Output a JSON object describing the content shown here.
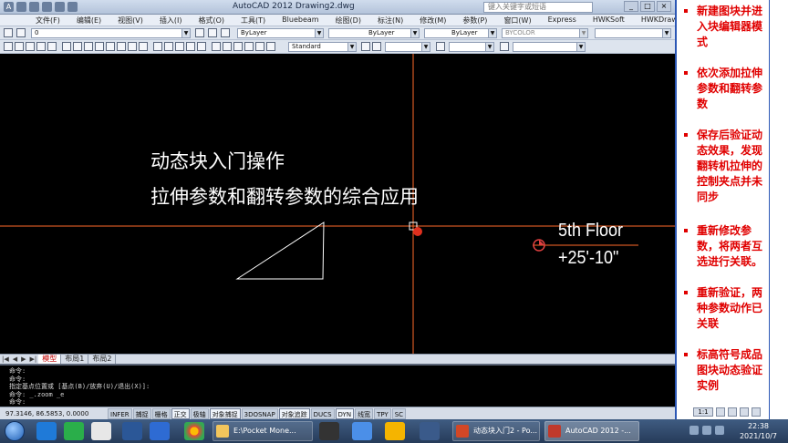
{
  "window": {
    "title": "AutoCAD 2012    Drawing2.dwg",
    "search_placeholder": "键入关键字或短语"
  },
  "menu": [
    "文件(F)",
    "编辑(E)",
    "视图(V)",
    "插入(I)",
    "格式(O)",
    "工具(T)",
    "Bluebeam",
    "绘图(D)",
    "标注(N)",
    "修改(M)",
    "参数(P)",
    "窗口(W)",
    "Express",
    "HWKSoft",
    "HWKDraw"
  ],
  "toolbar": {
    "layer_value": "0",
    "color_value": "ByLayer",
    "linetype_value": "ByLayer",
    "lineweight_value": "ByLayer",
    "plotstyle_value": "BYCOLOR",
    "textstyle_value": "Standard"
  },
  "drawing": {
    "annotation_line1": "动态块入门操作",
    "annotation_line2": "拉伸参数和翻转参数的综合应用",
    "floor_name": "5th Floor",
    "floor_elevation": "+25'-10\""
  },
  "layout_tabs": {
    "nav": [
      "|◀",
      "◀",
      "▶",
      "▶|"
    ],
    "tabs": [
      "模型",
      "布局1",
      "布局2"
    ],
    "active": "模型"
  },
  "command_history": [
    "命令:",
    "命令:",
    "指定基点位置或 [基点(B)/放弃(U)/退出(X)]:",
    "命令: _.zoom _e",
    "命令:"
  ],
  "status": {
    "coordinates": "97.3146, 86.5853, 0.0000",
    "toggles": [
      {
        "label": "INFER",
        "on": false
      },
      {
        "label": "捕捉",
        "on": false
      },
      {
        "label": "栅格",
        "on": false
      },
      {
        "label": "正交",
        "on": true
      },
      {
        "label": "极轴",
        "on": false
      },
      {
        "label": "对象捕捉",
        "on": true
      },
      {
        "label": "3DOSNAP",
        "on": false
      },
      {
        "label": "对象追踪",
        "on": true
      },
      {
        "label": "DUCS",
        "on": false
      },
      {
        "label": "DYN",
        "on": true
      },
      {
        "label": "线宽",
        "on": false
      },
      {
        "label": "TPY",
        "on": false
      },
      {
        "label": "SC",
        "on": false
      }
    ],
    "scale_label": "1:1"
  },
  "notes": [
    "新建图块并进入块编辑器模式",
    "依次添加拉伸参数和翻转参数",
    "保存后验证动态效果，发现翻转机拉伸的控制夹点并未同步",
    "重新修改参数，将两者互选进行关联。",
    "重新验证，两种参数动作已关联",
    "标高符号成品图块动态验证实例"
  ],
  "taskbar": {
    "windows": [
      "E:\\Pocket Mone...",
      "动态块入门2 - Po...",
      "AutoCAD 2012 -..."
    ],
    "time": "22:38",
    "date": "2021/10/7"
  },
  "colors": {
    "notes_text": "#e00000",
    "drawing_background": "#000000",
    "crosshair": "#ff6a2a"
  }
}
